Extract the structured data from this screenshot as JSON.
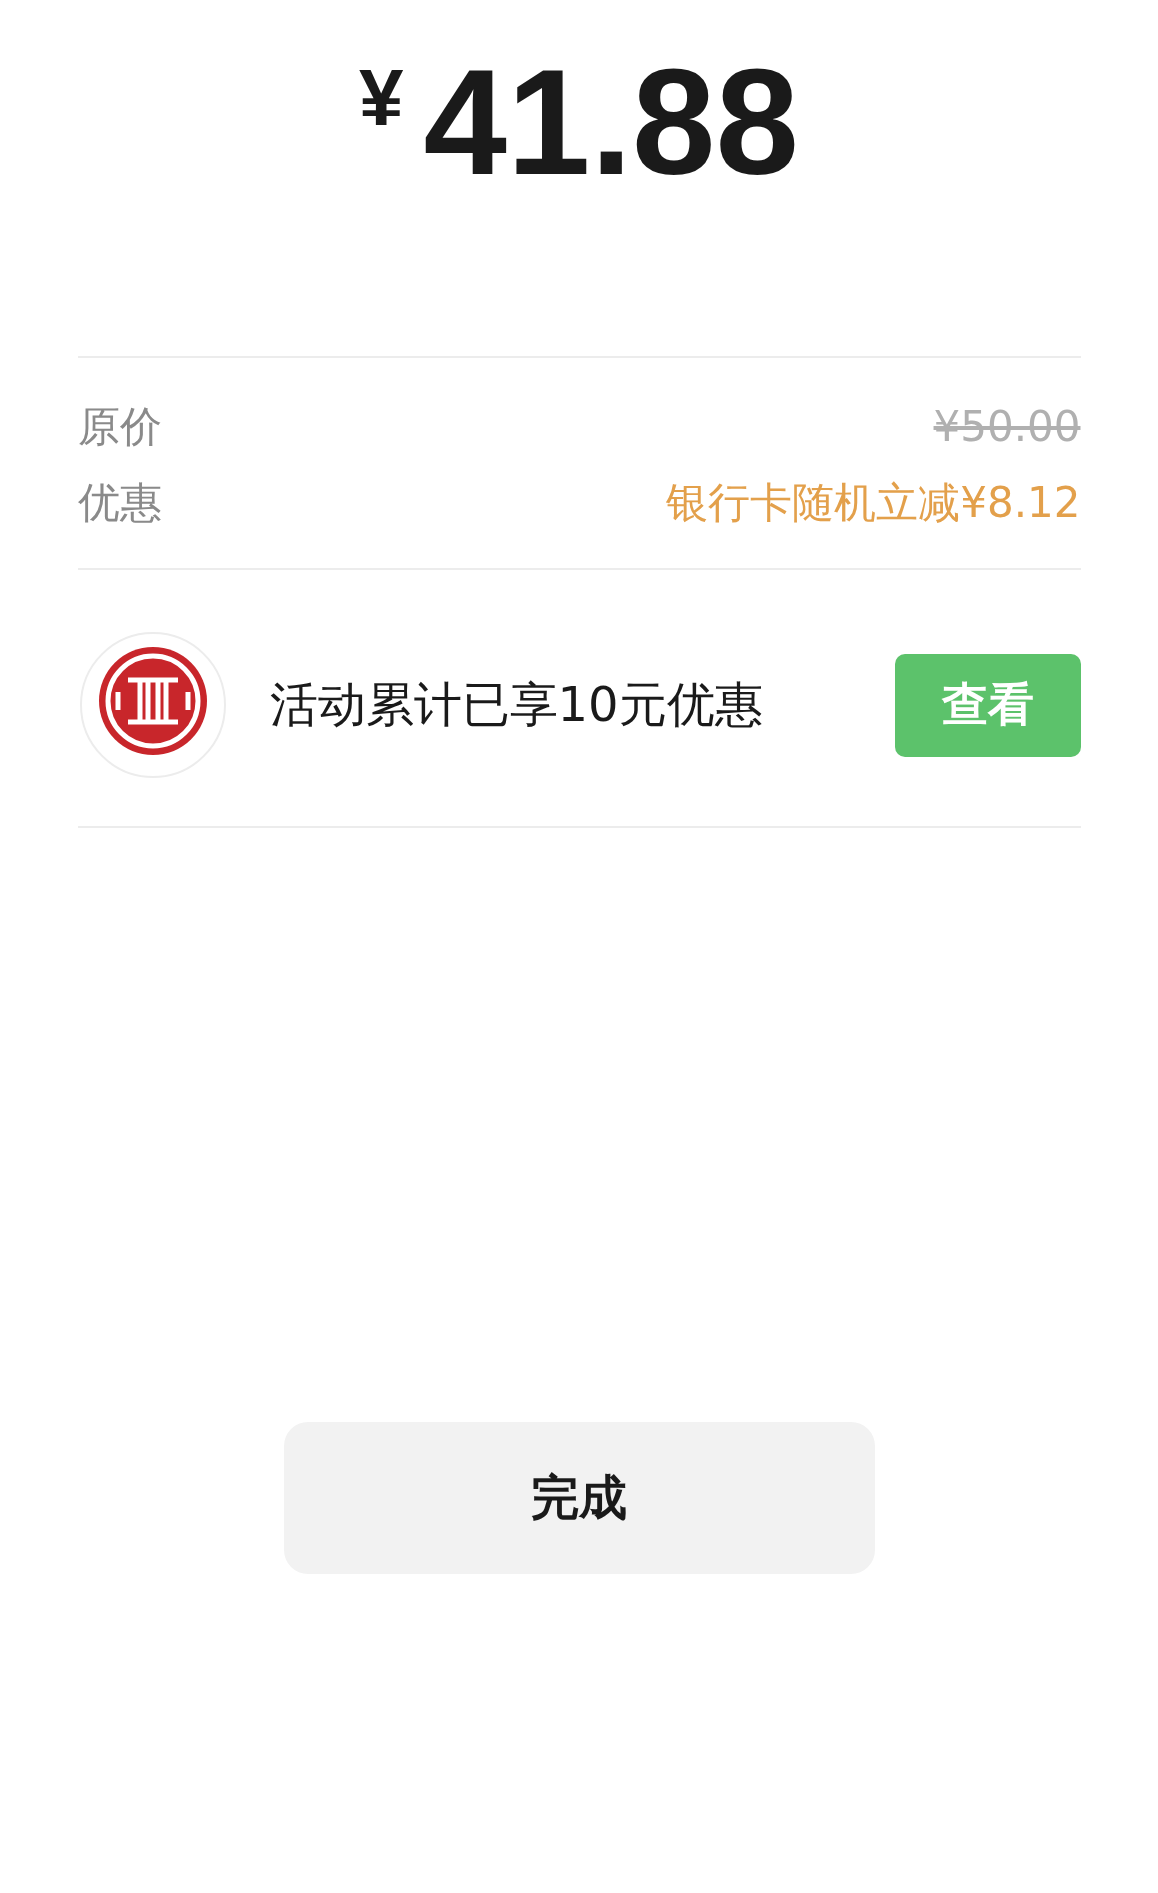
{
  "amount": {
    "currency": "¥",
    "value": "41.88"
  },
  "details": [
    {
      "label": "原价",
      "value": "¥50.00",
      "kind": "struck"
    },
    {
      "label": "优惠",
      "value": "银行卡随机立减¥8.12",
      "kind": "discount"
    }
  ],
  "promo": {
    "text": "活动累计已享10元优惠",
    "button": "查看"
  },
  "done_button": "完成"
}
